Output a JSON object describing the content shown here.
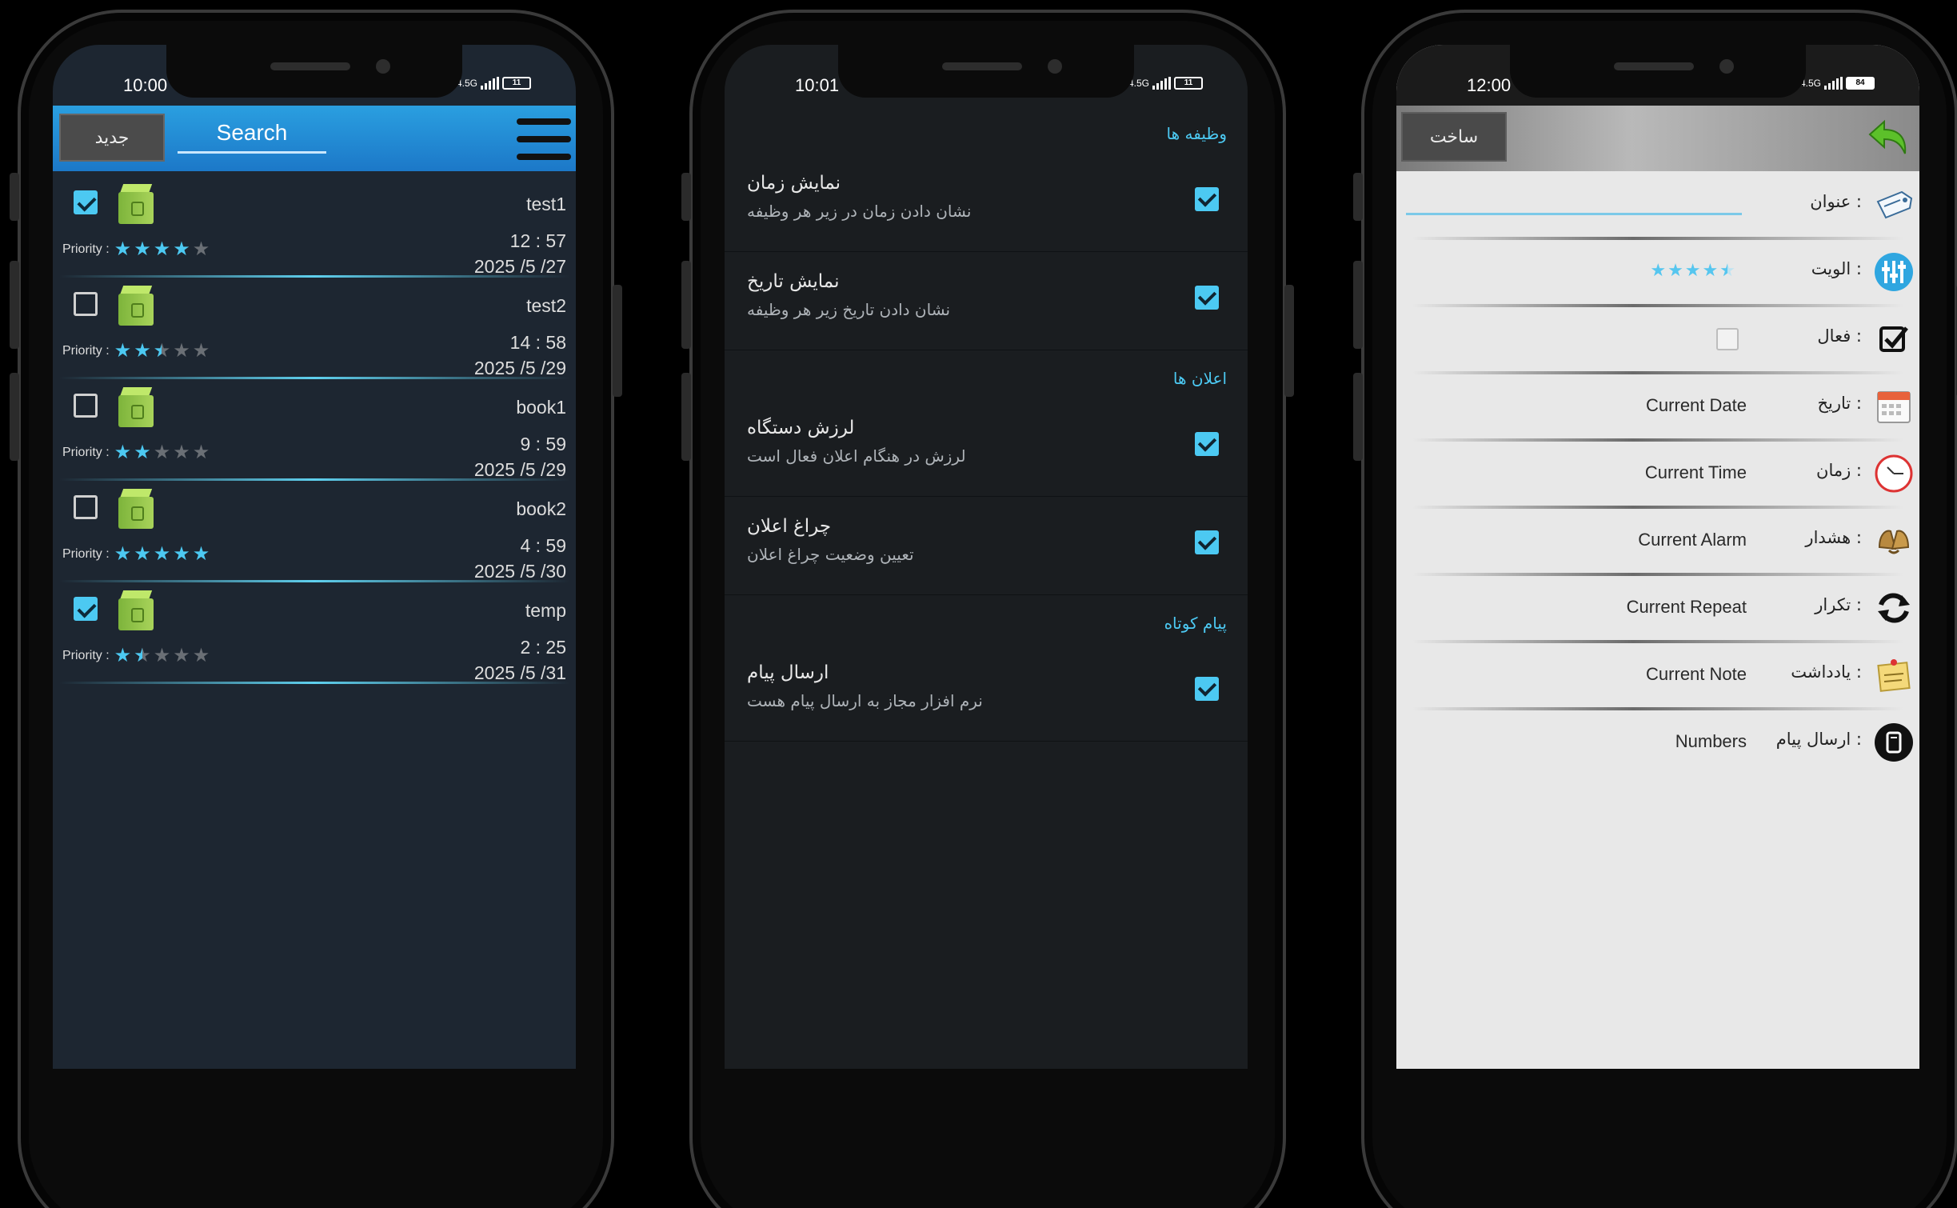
{
  "phone1": {
    "status_time": "10:00",
    "network": "4.5G",
    "battery": "11",
    "new_button": "جدید",
    "search_placeholder": "Search",
    "priority_label": "Priority :",
    "tasks": [
      {
        "name": "test1",
        "time": "12 : 57",
        "date": "2025 /5 /27",
        "checked": true,
        "priority": 4
      },
      {
        "name": "test2",
        "time": "14 : 58",
        "date": "2025 /5 /29",
        "checked": false,
        "priority": 2.5
      },
      {
        "name": "book1",
        "time": "9 : 59",
        "date": "2025 /5 /29",
        "checked": false,
        "priority": 2
      },
      {
        "name": "book2",
        "time": "4 : 59",
        "date": "2025 /5 /30",
        "checked": false,
        "priority": 5
      },
      {
        "name": "temp",
        "time": "2 : 25",
        "date": "2025 /5 /31",
        "checked": true,
        "priority": 1.5
      }
    ]
  },
  "phone2": {
    "status_time": "10:01",
    "network": "4.5G",
    "battery": "11",
    "sections": [
      {
        "header": "وظیفه ها",
        "items": [
          {
            "title": "نمایش زمان",
            "subtitle": "نشان دادن زمان در زیر هر وظیفه",
            "checked": true
          },
          {
            "title": "نمایش تاریخ",
            "subtitle": "نشان دادن تاریخ زیر هر وظیفه",
            "checked": true
          }
        ]
      },
      {
        "header": "اعلان ها",
        "items": [
          {
            "title": "لرزش دستگاه",
            "subtitle": "لرزش در هنگام اعلان فعال است",
            "checked": true
          },
          {
            "title": "چراغ اعلان",
            "subtitle": "تعیین وضعیت چراغ اعلان",
            "checked": true
          }
        ]
      },
      {
        "header": "پیام کوتاه",
        "items": [
          {
            "title": "ارسال پیام",
            "subtitle": "نرم افزار مجاز به ارسال پیام هست",
            "checked": true
          }
        ]
      }
    ]
  },
  "phone3": {
    "status_time": "12:00",
    "network": "4.5G",
    "battery": "84",
    "make_button": "ساخت",
    "fields": {
      "title_label": "عنوان :",
      "priority_label": "الویت :",
      "priority_value": 4.5,
      "active_label": "فعال :",
      "active_checked": false,
      "date_label": "تاریخ :",
      "date_value": "Current Date",
      "time_label": "زمان :",
      "time_value": "Current Time",
      "alarm_label": "هشدار :",
      "alarm_value": "Current Alarm",
      "repeat_label": "تکرار :",
      "repeat_value": "Current Repeat",
      "note_label": "یادداشت :",
      "note_value": "Current Note",
      "sms_label": "ارسال پیام :",
      "sms_value": "Numbers"
    }
  },
  "colors": {
    "accent": "#4cc9f2",
    "list_bg": "#1d2631",
    "settings_bg": "#1a1d20",
    "form_bg": "#e8e8e8"
  }
}
